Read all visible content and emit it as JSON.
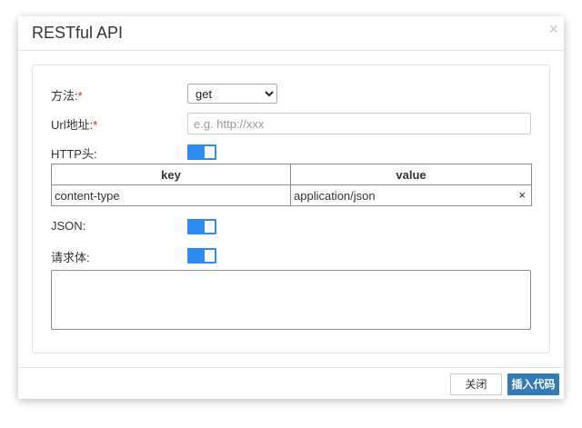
{
  "dialog": {
    "title": "RESTful API",
    "close_icon": "×"
  },
  "form": {
    "method_label": "方法:",
    "method_value": "get",
    "method_options": [
      "get"
    ],
    "url_label": "Url地址:",
    "url_placeholder": "e.g. http://xxx",
    "required_mark": "*",
    "headers_label": "HTTP头:",
    "headers_enabled": true,
    "json_label": "JSON:",
    "json_enabled": true,
    "body_label": "请求体:",
    "body_enabled": true,
    "body_value": ""
  },
  "headers_table": {
    "columns": [
      "key",
      "value"
    ],
    "rows": [
      {
        "key": "content-type",
        "value": "application/json",
        "delete_icon": "×"
      }
    ]
  },
  "footer": {
    "close_label": "关闭",
    "insert_label": "插入代码"
  },
  "colors": {
    "toggle_on": "#2d8cf0",
    "primary_button": "#337ab7",
    "required": "#e1251b"
  }
}
